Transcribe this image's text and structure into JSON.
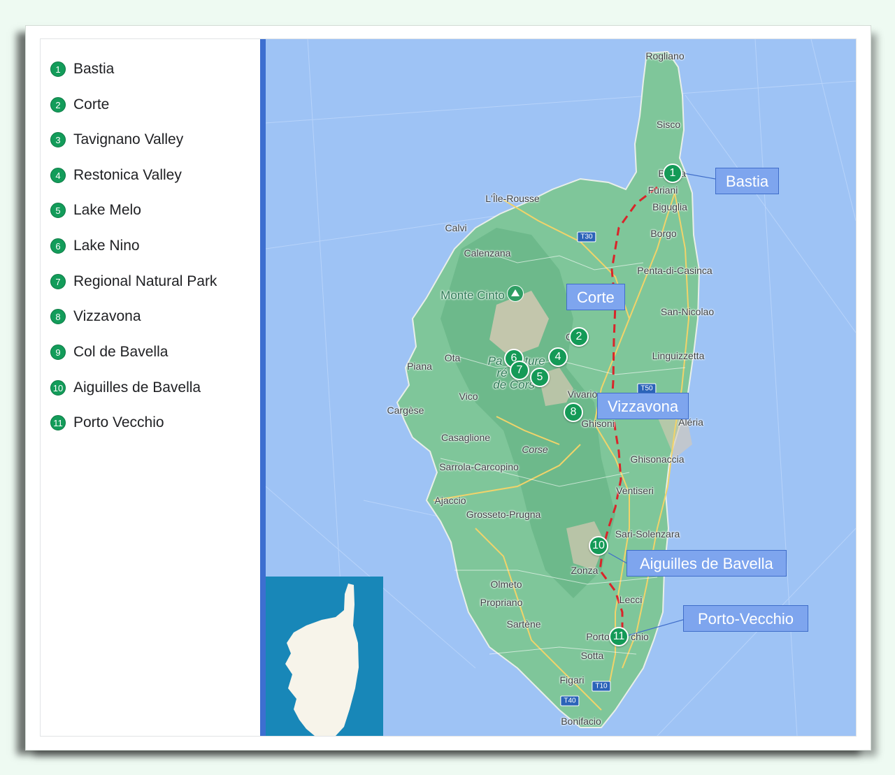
{
  "legend": {
    "items": [
      {
        "num": "1",
        "label": "Bastia"
      },
      {
        "num": "2",
        "label": "Corte"
      },
      {
        "num": "3",
        "label": "Tavignano Valley"
      },
      {
        "num": "4",
        "label": "Restonica Valley"
      },
      {
        "num": "5",
        "label": "Lake Melo"
      },
      {
        "num": "6",
        "label": "Lake Nino"
      },
      {
        "num": "7",
        "label": "Regional Natural Park"
      },
      {
        "num": "8",
        "label": "Vizzavona"
      },
      {
        "num": "9",
        "label": "Col de Bavella"
      },
      {
        "num": "10",
        "label": "Aiguilles de Bavella"
      },
      {
        "num": "11",
        "label": "Porto Vecchio"
      }
    ]
  },
  "map": {
    "markers": [
      "1",
      "2",
      "4",
      "6",
      "7",
      "5",
      "8",
      "10",
      "11"
    ],
    "callouts": {
      "bastia": "Bastia",
      "corte": "Corte",
      "vizzavona": "Vizzavona",
      "bavella": "Aiguilles de Bavella",
      "porto_vecchio": "Porto-Vecchio"
    },
    "places": {
      "rogliano": "Rogliano",
      "sisco": "Sisco",
      "bastia_partial": "B",
      "bastia_partial_end": "a",
      "furiani": "Furiani",
      "biguglia": "Biguglia",
      "borgo": "Borgo",
      "penta": "Penta-di-Casinca",
      "san_nicolao": "San-Nicolao",
      "linguizzetta": "Linguizzetta",
      "aleria": "Aléria",
      "ghisonaccia": "Ghisonaccia",
      "ventiseri": "Ventiseri",
      "sari": "Sari-Solenzara",
      "lile_rousse": "L'Île-Rousse",
      "calvi": "Calvi",
      "calenzana": "Calenzana",
      "monte_cinto": "Monte Cinto",
      "corte_partial": "C",
      "ota": "Ota",
      "piana": "Piana",
      "park_a": "Pa",
      "park_b": "ture",
      "park_c": "ré",
      "park_d": "de Cors",
      "vico": "Vico",
      "vivario": "Vivario",
      "ghisoni": "Ghisoni",
      "cargese": "Cargèse",
      "casaglione": "Casaglione",
      "corse": "Corse",
      "sarrola": "Sarrola-Carcopino",
      "ajaccio": "Ajaccio",
      "grosseto": "Grosseto-Prugna",
      "zonza": "Zonza",
      "olmeto": "Olmeto",
      "propriano": "Propriano",
      "lecci": "Lecci",
      "sartene": "Sartène",
      "porto_a": "Porto",
      "porto_b": "chio",
      "sotta": "Sotta",
      "figari": "Figari",
      "bonifacio": "Bonifacio"
    },
    "roads": {
      "t30": "T30",
      "t50": "T50",
      "t10": "T10",
      "t40": "T40"
    },
    "colors": {
      "sea": "#9ec3f5",
      "land": "#7fc69a",
      "route": "#d9252a",
      "marker": "#149a57",
      "callout": "#7ea5ee"
    }
  }
}
